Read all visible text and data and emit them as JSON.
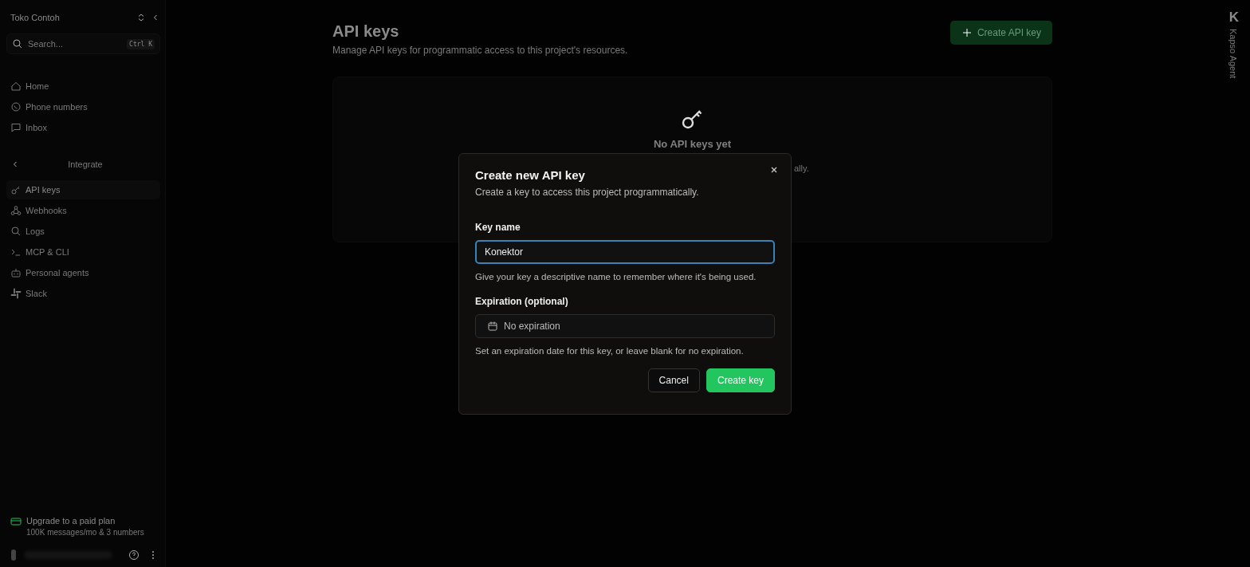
{
  "sidebar": {
    "workspace": "Toko Contoh",
    "search": {
      "placeholder": "Search...",
      "shortcut": "Ctrl K"
    },
    "items": [
      {
        "label": "Home",
        "selected": false
      },
      {
        "label": "Phone numbers",
        "selected": false
      },
      {
        "label": "Inbox",
        "selected": false
      }
    ],
    "section": "Integrate",
    "section_items": [
      {
        "label": "API keys",
        "selected": true
      },
      {
        "label": "Webhooks",
        "selected": false
      },
      {
        "label": "Logs",
        "selected": false
      },
      {
        "label": "MCP & CLI",
        "selected": false
      },
      {
        "label": "Personal agents",
        "selected": false
      },
      {
        "label": "Slack",
        "selected": false
      }
    ],
    "upgrade": {
      "title": "Upgrade to a paid plan",
      "subtitle": "100K messages/mo & 3 numbers"
    }
  },
  "page": {
    "title": "API keys",
    "subtitle": "Manage API keys for programmatic access to this project's resources.",
    "create_button": "Create API key",
    "empty": {
      "title": "No API keys yet",
      "description_visible": "ally."
    }
  },
  "agent_rail": {
    "logo": "K",
    "label": "Kapso Agent"
  },
  "dialog": {
    "title": "Create new API key",
    "description": "Create a key to access this project programmatically.",
    "fields": [
      {
        "kind": "text",
        "label": "Key name",
        "value": "Konektor",
        "focused": true,
        "hint": "Give your key a descriptive name to remember where it's being used."
      },
      {
        "kind": "date",
        "label": "Expiration (optional)",
        "placeholder": "No expiration",
        "focused": false,
        "hint": "Set an expiration date for this key, or leave blank for no expiration."
      }
    ],
    "buttons": [
      {
        "label": "Cancel",
        "kind": "secondary"
      },
      {
        "label": "Create key",
        "kind": "primary"
      }
    ]
  }
}
